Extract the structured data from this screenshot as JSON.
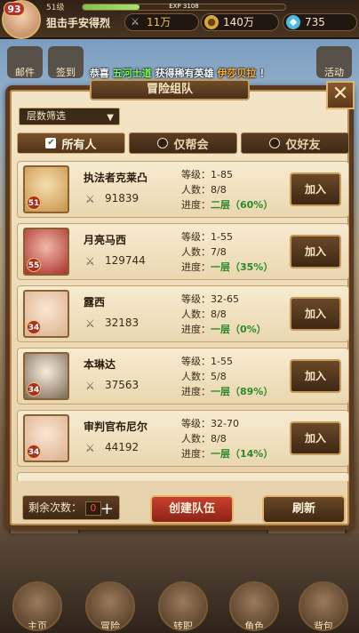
{
  "topbar": {
    "player_level": "93",
    "level_label": "51级",
    "exp_text": "EXP 3108",
    "exp_fraction": 0.28,
    "player_name": "狙击手安得烈",
    "power": "11万",
    "gold": "140万",
    "gems": "735"
  },
  "nav_bg": {
    "items": [
      "邮件",
      "签到",
      "活动"
    ]
  },
  "announcement": {
    "prefix": "恭喜 ",
    "player": "五河士道",
    "middle": " 获得稀有英雄 ",
    "hero": "伊莎贝拉",
    "suffix": " ！"
  },
  "dialog": {
    "title": "冒险组队",
    "close": "✕",
    "filter_label": "层数筛选",
    "tabs": [
      {
        "label": "所有人",
        "active": true
      },
      {
        "label": "仅帮会",
        "active": false
      },
      {
        "label": "仅好友",
        "active": false
      }
    ],
    "labels": {
      "level": "等级：",
      "members": "人数：",
      "progress": "进度："
    },
    "teams": [
      {
        "name": "执法者克莱凸",
        "hero_level": "51",
        "power": "91839",
        "level_range": "1-85",
        "members": "8/8",
        "progress": "二层（60%）"
      },
      {
        "name": "月亮马西",
        "hero_level": "55",
        "power": "129744",
        "level_range": "1-55",
        "members": "7/8",
        "progress": "一层（35%）"
      },
      {
        "name": "露西",
        "hero_level": "34",
        "power": "32183",
        "level_range": "32-65",
        "members": "8/8",
        "progress": "一层（0%）"
      },
      {
        "name": "本琳达",
        "hero_level": "34",
        "power": "37563",
        "level_range": "1-55",
        "members": "5/8",
        "progress": "一层（89%）"
      },
      {
        "name": "审判官布尼尔",
        "hero_level": "34",
        "power": "44192",
        "level_range": "32-70",
        "members": "8/8",
        "progress": "一层（14%）"
      }
    ],
    "join_label": "加入",
    "remaining_label": "剩余次数：",
    "remaining_count": "0",
    "create_label": "创建队伍",
    "refresh_label": "刷新"
  },
  "bottom_nav": [
    "主页",
    "冒险",
    "转职",
    "角色",
    "背包"
  ]
}
